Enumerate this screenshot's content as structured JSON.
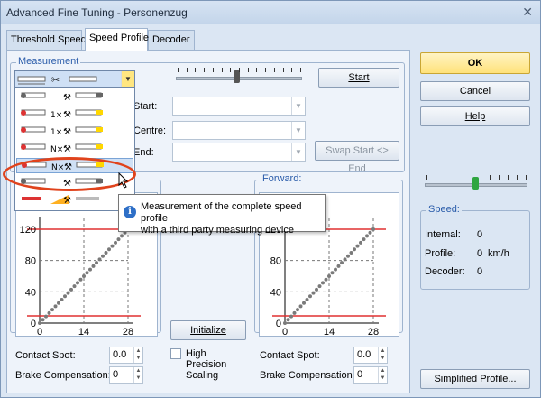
{
  "window": {
    "title": "Advanced Fine Tuning - Personenzug",
    "close_icon": "close-icon"
  },
  "tabs": [
    {
      "label": "Threshold Speed"
    },
    {
      "label": "Speed Profile",
      "active": true
    },
    {
      "label": "Decoder"
    }
  ],
  "measurement": {
    "group_label": "Measurement",
    "start_button": "Start",
    "start_label": "Start:",
    "centre_label": "Centre:",
    "end_label": "End:",
    "swap_button": "Swap Start <> End"
  },
  "tooltip": {
    "line1": "Measurement of the complete speed profile",
    "line2": "with a third party measuring device"
  },
  "dropdown": {
    "items": [
      "",
      "1×",
      "1×",
      "N×",
      "N×",
      "",
      ""
    ],
    "highlighted_index": 4
  },
  "forward": {
    "group_label": "Forward:"
  },
  "backward_chart": {
    "y_ticks": [
      "120",
      "80",
      "40",
      "0"
    ],
    "x_ticks": [
      "0",
      "14",
      "28"
    ]
  },
  "forward_chart": {
    "y_ticks": [
      "120",
      "80",
      "40",
      "0"
    ],
    "x_ticks": [
      "0",
      "14",
      "28"
    ]
  },
  "initialize_button": "Initialize",
  "high_precision_label": [
    "High",
    "Precision",
    "Scaling"
  ],
  "left_fields": {
    "contact_spot_label": "Contact Spot:",
    "contact_spot_value": "0.0",
    "brake_comp_label": "Brake Compensation:",
    "brake_comp_value": "0"
  },
  "right_fields": {
    "contact_spot_label": "Contact Spot:",
    "contact_spot_value": "0.0",
    "brake_comp_label": "Brake Compensation:",
    "brake_comp_value": "0"
  },
  "buttons": {
    "ok": "OK",
    "cancel": "Cancel",
    "help": "Help",
    "simplified": "Simplified Profile..."
  },
  "speed": {
    "group_label": "Speed:",
    "internal_label": "Internal:",
    "internal_value": "0",
    "profile_label": "Profile:",
    "profile_value": "0",
    "profile_unit": "km/h",
    "decoder_label": "Decoder:",
    "decoder_value": "0"
  },
  "colors": {
    "accent_ok": "#ffe680",
    "ring": "#e0431c",
    "chart_limit": "#e03030",
    "chart_points": "#7a7a7a"
  }
}
